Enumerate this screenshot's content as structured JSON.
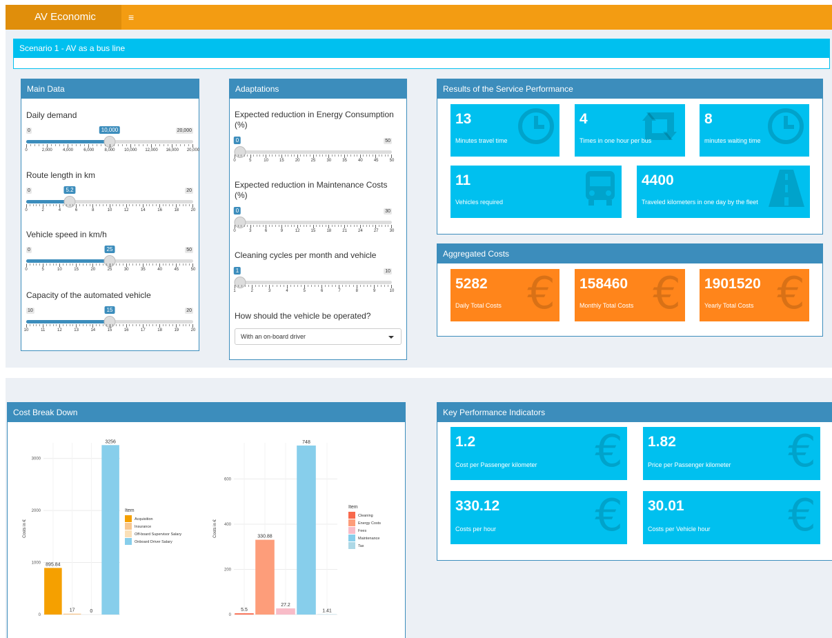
{
  "header": {
    "app_title": "AV Economic",
    "menu_icon": "hamburger-icon"
  },
  "scenario": {
    "title": "Scenario 1 - AV as a bus line"
  },
  "main_data": {
    "title": "Main Data",
    "sliders": [
      {
        "label": "Daily demand",
        "min_label": "0",
        "max_label": "20,000",
        "value_label": "10,000",
        "value_fraction": 0.5,
        "ticks": [
          "0",
          "2,000",
          "4,000",
          "6,000",
          "8,000",
          "10,000",
          "12,000",
          "16,000",
          "20,000"
        ]
      },
      {
        "label": "Route length in km",
        "min_label": "0",
        "max_label": "20",
        "value_label": "5.2",
        "value_fraction": 0.26,
        "ticks": [
          "0",
          "2",
          "4",
          "6",
          "8",
          "10",
          "12",
          "14",
          "16",
          "18",
          "20"
        ]
      },
      {
        "label": "Vehicle speed in km/h",
        "min_label": "0",
        "max_label": "50",
        "value_label": "25",
        "value_fraction": 0.5,
        "ticks": [
          "0",
          "5",
          "10",
          "15",
          "20",
          "25",
          "30",
          "35",
          "40",
          "45",
          "50"
        ]
      },
      {
        "label": "Capacity of the automated vehicle",
        "min_label": "10",
        "max_label": "20",
        "value_label": "15",
        "value_fraction": 0.5,
        "ticks": [
          "10",
          "11",
          "12",
          "13",
          "14",
          "15",
          "16",
          "17",
          "18",
          "19",
          "20"
        ]
      }
    ]
  },
  "adaptations": {
    "title": "Adaptations",
    "sliders": [
      {
        "label": "Expected reduction in Energy Consumption (%)",
        "min_label": "",
        "max_label": "50",
        "value_label": "0",
        "value_fraction": 0,
        "ticks": [
          "0",
          "5",
          "10",
          "15",
          "20",
          "25",
          "30",
          "35",
          "40",
          "45",
          "50"
        ]
      },
      {
        "label": "Expected reduction in Maintenance Costs (%)",
        "min_label": "",
        "max_label": "30",
        "value_label": "0",
        "value_fraction": 0,
        "ticks": [
          "0",
          "3",
          "6",
          "9",
          "12",
          "15",
          "18",
          "21",
          "24",
          "27",
          "30"
        ]
      },
      {
        "label": "Cleaning cycles per month and vehicle",
        "min_label": "",
        "max_label": "10",
        "value_label": "1",
        "value_fraction": 0,
        "ticks": [
          "1",
          "2",
          "3",
          "4",
          "5",
          "6",
          "7",
          "8",
          "9",
          "10"
        ]
      }
    ],
    "operation_label": "How should the vehicle be operated?",
    "operation_selected": "With an on-board driver"
  },
  "results": {
    "title": "Results of the Service Performance",
    "boxes": [
      {
        "value": "13",
        "text": "Minutes travel time",
        "icon": "clock-icon"
      },
      {
        "value": "4",
        "text": "Times in one hour per bus",
        "icon": "retweet-icon"
      },
      {
        "value": "8",
        "text": "minutes waiting time",
        "icon": "clock-icon"
      },
      {
        "value": "11",
        "text": "Vehicles required",
        "icon": "bus-icon"
      },
      {
        "value": "4400",
        "text": "Traveled kilometers in one day by the fleet",
        "icon": "road-icon"
      }
    ]
  },
  "aggregated": {
    "title": "Aggregated Costs",
    "boxes": [
      {
        "value": "5282",
        "text": "Daily Total Costs",
        "icon": "euro-icon"
      },
      {
        "value": "158460",
        "text": "Monthly Total Costs",
        "icon": "euro-icon"
      },
      {
        "value": "1901520",
        "text": "Yearly Total Costs",
        "icon": "euro-icon"
      }
    ]
  },
  "cost_breakdown": {
    "title": "Cost Break Down",
    "euro_glyph": "€"
  },
  "kpi": {
    "title": "Key Performance Indicators",
    "boxes": [
      {
        "value": "1.2",
        "text": "Cost per Passenger kilometer",
        "icon": "euro-icon"
      },
      {
        "value": "1.82",
        "text": "Price per Passenger kilometer",
        "icon": "euro-icon"
      },
      {
        "value": "330.12",
        "text": "Costs per hour",
        "icon": "euro-icon"
      },
      {
        "value": "30.01",
        "text": "Costs per Vehicle hour",
        "icon": "euro-icon"
      }
    ]
  },
  "colors": {
    "header": "#f39c12",
    "brand": "#e08e0b",
    "aqua": "#00c0ef",
    "orange": "#ff851b",
    "box_header": "#3c8dbc"
  },
  "chart_data": [
    {
      "type": "bar",
      "categories": [
        "Acquisition",
        "Insurance",
        "Off-board Supervisor Salary",
        "Onboard Driver Salary"
      ],
      "values": [
        895.84,
        17,
        0,
        3256
      ],
      "data_labels": [
        "895.84",
        "17",
        "0",
        "3256"
      ],
      "colors": [
        "#f5a000",
        "#f8c78f",
        "#fae0b8",
        "#87ceeb"
      ],
      "ylabel": "Costs in €",
      "ylim": [
        0,
        3300
      ],
      "yticks": [
        0,
        1000,
        2000,
        3000
      ],
      "legend_title": "Item",
      "legend_position": "right",
      "grid": true
    },
    {
      "type": "bar",
      "categories": [
        "Cleaning",
        "Energy Costs",
        "Fees",
        "Maintenance",
        "Tax"
      ],
      "values": [
        5.5,
        330.88,
        27.2,
        748,
        1.41
      ],
      "data_labels": [
        "5.5",
        "330.88",
        "27.2",
        "748",
        "1.41"
      ],
      "colors": [
        "#f8694c",
        "#fd9d7a",
        "#f8bcc8",
        "#87ceeb",
        "#add8e6"
      ],
      "ylabel": "Costs in €",
      "ylim": [
        0,
        760
      ],
      "yticks": [
        0,
        200,
        400,
        600
      ],
      "legend_title": "Item",
      "legend_position": "right",
      "grid": true
    }
  ]
}
